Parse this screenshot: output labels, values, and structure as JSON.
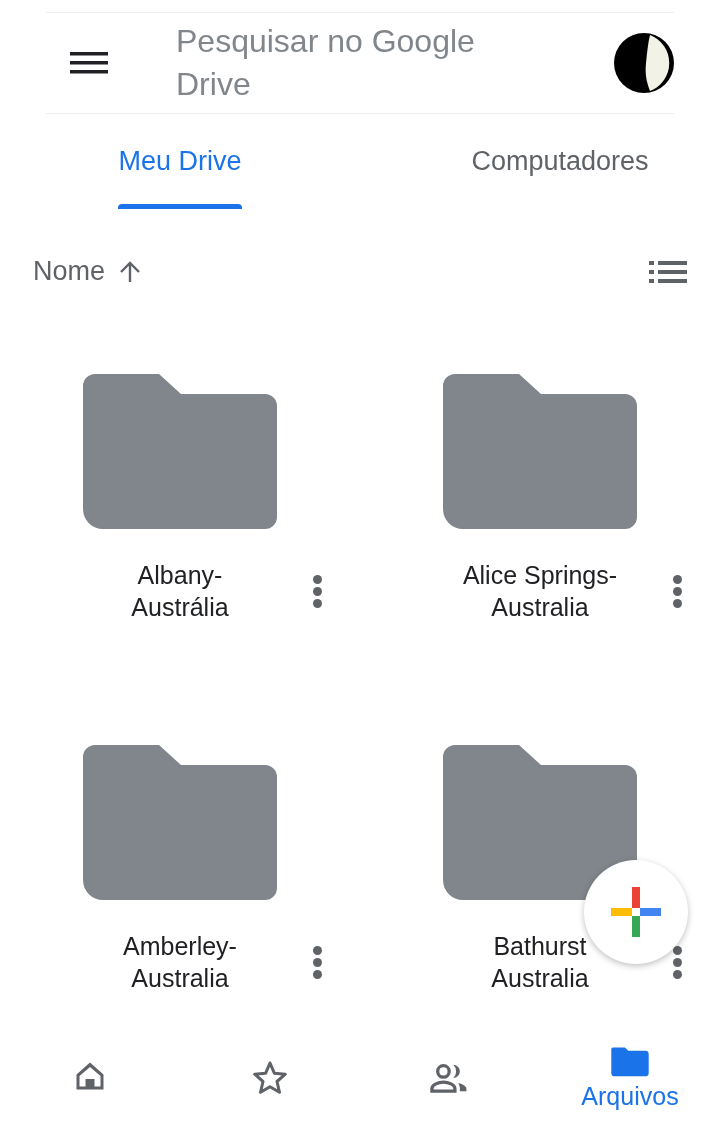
{
  "search": {
    "placeholder": "Pesquisar no Google Drive"
  },
  "tabs": [
    {
      "label": "Meu Drive",
      "selected": true
    },
    {
      "label": "Computadores",
      "selected": false
    }
  ],
  "sort": {
    "label": "Nome"
  },
  "folders": [
    {
      "name": "Albany-\nAustrália"
    },
    {
      "name": "Alice Springs-\nAustralia"
    },
    {
      "name": "Amberley-\nAustralia"
    },
    {
      "name": "Bathurst\nAustralia"
    }
  ],
  "nav": [
    {
      "kind": "home",
      "selected": false
    },
    {
      "kind": "starred",
      "selected": false
    },
    {
      "kind": "shared",
      "selected": false
    },
    {
      "kind": "files",
      "selected": true,
      "label": "Arquivos"
    }
  ]
}
